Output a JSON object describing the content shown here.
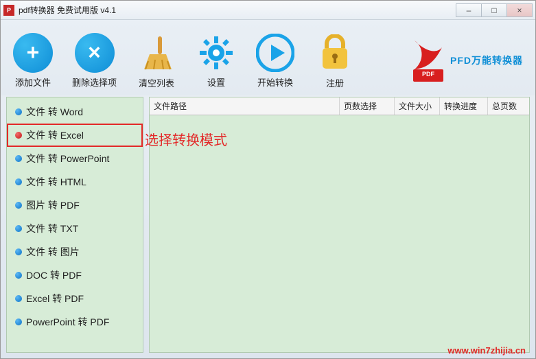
{
  "window": {
    "title": "pdf转换器 免费试用版 v4.1"
  },
  "toolbar": {
    "add_file": "添加文件",
    "delete_selected": "删除选择项",
    "clear_list": "清空列表",
    "settings": "设置",
    "start_convert": "开始转换",
    "register": "注册"
  },
  "brand": {
    "text": "PFD万能转换器"
  },
  "sidebar": {
    "items": [
      {
        "label": "文件 转 Word",
        "bullet": "blue",
        "selected": false
      },
      {
        "label": "文件 转 Excel",
        "bullet": "red",
        "selected": true
      },
      {
        "label": "文件 转 PowerPoint",
        "bullet": "blue",
        "selected": false
      },
      {
        "label": "文件 转 HTML",
        "bullet": "blue",
        "selected": false
      },
      {
        "label": "图片 转 PDF",
        "bullet": "blue",
        "selected": false
      },
      {
        "label": "文件 转 TXT",
        "bullet": "blue",
        "selected": false
      },
      {
        "label": "文件 转 图片",
        "bullet": "blue",
        "selected": false
      },
      {
        "label": "DOC 转 PDF",
        "bullet": "blue",
        "selected": false
      },
      {
        "label": "Excel 转 PDF",
        "bullet": "blue",
        "selected": false
      },
      {
        "label": "PowerPoint 转 PDF",
        "bullet": "blue",
        "selected": false
      }
    ]
  },
  "annotation": {
    "text": "选择转换模式"
  },
  "table": {
    "columns": {
      "path": "文件路径",
      "page_select": "页数选择",
      "file_size": "文件大小",
      "progress": "转换进度",
      "total_pages": "总页数"
    },
    "rows": []
  },
  "watermark": "www.win7zhijia.cn"
}
